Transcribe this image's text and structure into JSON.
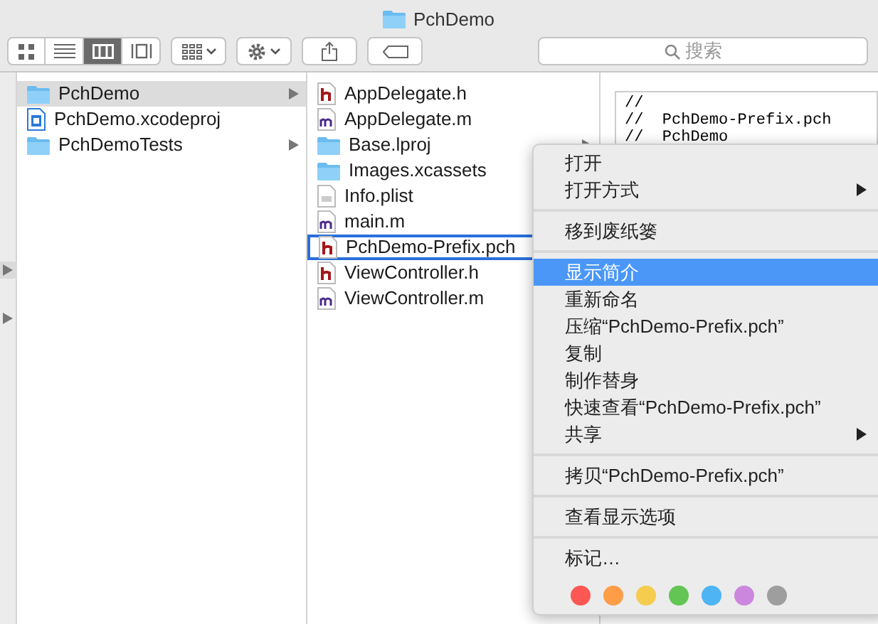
{
  "window": {
    "title": "PchDemo"
  },
  "toolbar": {
    "view_modes": [
      {
        "selected": false
      },
      {
        "selected": false
      },
      {
        "selected": true
      },
      {
        "selected": false
      }
    ],
    "search": {
      "placeholder": "搜索"
    }
  },
  "columns": [
    {
      "items": [
        {
          "name": "PchDemo",
          "kind": "folder",
          "selected": true,
          "has_children": true
        },
        {
          "name": "PchDemo.xcodeproj",
          "kind": "project",
          "selected": false,
          "has_children": false
        },
        {
          "name": "PchDemoTests",
          "kind": "folder",
          "selected": false,
          "has_children": true
        }
      ]
    },
    {
      "items": [
        {
          "name": "AppDelegate.h",
          "kind": "h",
          "selected": false,
          "has_children": false
        },
        {
          "name": "AppDelegate.m",
          "kind": "m",
          "selected": false,
          "has_children": false
        },
        {
          "name": "Base.lproj",
          "kind": "folder",
          "selected": false,
          "has_children": true
        },
        {
          "name": "Images.xcassets",
          "kind": "folder",
          "selected": false,
          "has_children": false
        },
        {
          "name": "Info.plist",
          "kind": "plist",
          "selected": false,
          "has_children": false
        },
        {
          "name": "main.m",
          "kind": "m",
          "selected": false,
          "has_children": false
        },
        {
          "name": "PchDemo-Prefix.pch",
          "kind": "h",
          "selected": true,
          "has_children": false
        },
        {
          "name": "ViewController.h",
          "kind": "h",
          "selected": false,
          "has_children": false
        },
        {
          "name": "ViewController.m",
          "kind": "m",
          "selected": false,
          "has_children": false
        }
      ]
    }
  ],
  "preview": {
    "lines": [
      "//",
      "//  PchDemo-Prefix.pch",
      "//  PchDemo"
    ]
  },
  "context_menu": {
    "items": [
      {
        "kind": "item",
        "label": "打开",
        "submenu": false,
        "selected": false
      },
      {
        "kind": "item",
        "label": "打开方式",
        "submenu": true,
        "selected": false
      },
      {
        "kind": "separator"
      },
      {
        "kind": "item",
        "label": "移到废纸篓",
        "submenu": false,
        "selected": false
      },
      {
        "kind": "separator"
      },
      {
        "kind": "item",
        "label": "显示简介",
        "submenu": false,
        "selected": true
      },
      {
        "kind": "item",
        "label": "重新命名",
        "submenu": false,
        "selected": false
      },
      {
        "kind": "item",
        "label": "压缩“PchDemo-Prefix.pch”",
        "submenu": false,
        "selected": false
      },
      {
        "kind": "item",
        "label": "复制",
        "submenu": false,
        "selected": false
      },
      {
        "kind": "item",
        "label": "制作替身",
        "submenu": false,
        "selected": false
      },
      {
        "kind": "item",
        "label": "快速查看“PchDemo-Prefix.pch”",
        "submenu": false,
        "selected": false
      },
      {
        "kind": "item",
        "label": "共享",
        "submenu": true,
        "selected": false
      },
      {
        "kind": "separator"
      },
      {
        "kind": "item",
        "label": "拷贝“PchDemo-Prefix.pch”",
        "submenu": false,
        "selected": false
      },
      {
        "kind": "separator"
      },
      {
        "kind": "item",
        "label": "查看显示选项",
        "submenu": false,
        "selected": false
      },
      {
        "kind": "separator"
      },
      {
        "kind": "item",
        "label": "标记…",
        "submenu": false,
        "selected": false
      },
      {
        "kind": "colors",
        "colors": [
          {
            "color": "#fc5753"
          },
          {
            "color": "#fd9d47"
          },
          {
            "color": "#f6cc4e"
          },
          {
            "color": "#63c554"
          },
          {
            "color": "#4eb4f3"
          },
          {
            "color": "#cb87de"
          },
          {
            "color": "#9e9e9e"
          }
        ]
      }
    ]
  }
}
